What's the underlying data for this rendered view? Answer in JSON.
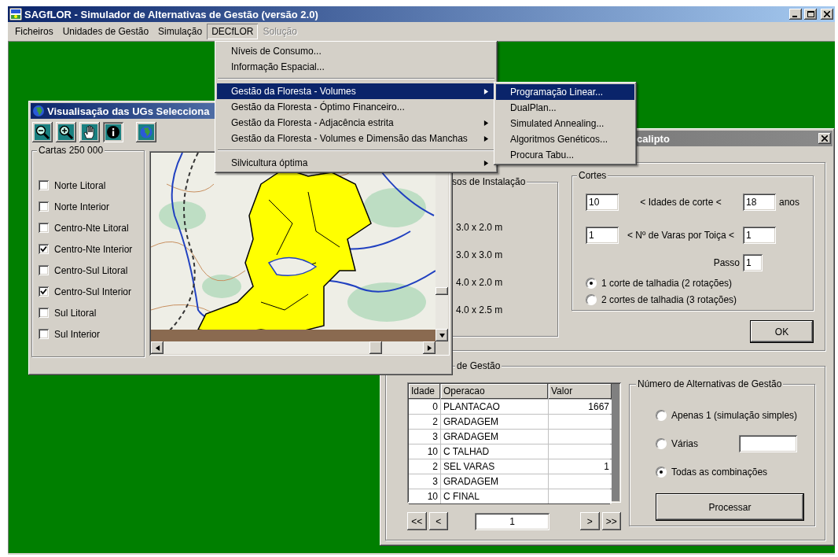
{
  "window": {
    "title": "SAGfLOR - Simulador de Alternativas de Gestão (versão 2.0)"
  },
  "menubar": [
    {
      "label": "Ficheiros",
      "open": false,
      "disabled": false
    },
    {
      "label": "Unidades de Gestão",
      "open": false,
      "disabled": false
    },
    {
      "label": "Simulação",
      "open": false,
      "disabled": false
    },
    {
      "label": "DECfLOR",
      "open": true,
      "disabled": false
    },
    {
      "label": "Solução",
      "open": false,
      "disabled": true
    }
  ],
  "menu": {
    "items": [
      {
        "kind": "item",
        "label": "Níveis de Consumo...",
        "selected": false,
        "submenu": false
      },
      {
        "kind": "item",
        "label": "Informação Espacial...",
        "selected": false,
        "submenu": false
      },
      {
        "kind": "separator"
      },
      {
        "kind": "item",
        "label": "Gestão da Floresta - Volumes",
        "selected": true,
        "submenu": true
      },
      {
        "kind": "item",
        "label": "Gestão da Floresta - Óptimo Financeiro...",
        "selected": false,
        "submenu": false
      },
      {
        "kind": "item",
        "label": "Gestão da Floresta - Adjacência estrita",
        "selected": false,
        "submenu": true
      },
      {
        "kind": "item",
        "label": "Gestão da Floresta - Volumes e Dimensão das Manchas",
        "selected": false,
        "submenu": true
      },
      {
        "kind": "separator"
      },
      {
        "kind": "item",
        "label": "Silvicultura óptima",
        "selected": false,
        "submenu": true
      }
    ]
  },
  "submenu": {
    "items": [
      {
        "label": "Programação Linear...",
        "selected": true
      },
      {
        "label": "DualPlan...",
        "selected": false
      },
      {
        "label": "Simulated Annealing...",
        "selected": false
      },
      {
        "label": "Algoritmos Genéticos...",
        "selected": false
      },
      {
        "label": "Procura Tabu...",
        "selected": false
      }
    ]
  },
  "map_window": {
    "title": "Visualisação das UGs Selecciona",
    "tools": [
      {
        "kind": "zoom-out",
        "pressed": false
      },
      {
        "kind": "zoom-in",
        "pressed": false
      },
      {
        "kind": "hand",
        "pressed": false
      },
      {
        "kind": "info",
        "pressed": true
      },
      {
        "kind": "globe",
        "pressed": false
      }
    ],
    "group": {
      "title": "Cartas 250 000",
      "items": [
        {
          "label": "Norte Litoral",
          "checked": false
        },
        {
          "label": "Norte Interior",
          "checked": false
        },
        {
          "label": "Centro-Nte Litoral",
          "checked": false
        },
        {
          "label": "Centro-Nte Interior",
          "checked": true
        },
        {
          "label": "Centro-Sul Litoral",
          "checked": false
        },
        {
          "label": "Centro-Sul Interior",
          "checked": true
        },
        {
          "label": "Sul Litoral",
          "checked": false
        },
        {
          "label": "Sul Interior",
          "checked": false
        }
      ]
    }
  },
  "dialog": {
    "title": "calipto",
    "spacing": {
      "title": "sos de Instalação",
      "options": [
        "3.0 x 2.0 m",
        "3.0 x 3.0 m",
        "4.0 x 2.0 m",
        "4.0 x 2.5 m"
      ]
    },
    "cuts": {
      "title": "Cortes",
      "age_min": "10",
      "age_label": "<  Idades de corte  <",
      "age_max": "18",
      "age_unit": "anos",
      "stems_min": "1",
      "stems_label": "< Nº de Varas por Toiça <",
      "stems_max": "1",
      "step_label": "Passo",
      "step": "1",
      "options": [
        {
          "label": "1 corte de talhadia (2 rotações)",
          "selected": true
        },
        {
          "label": "2 cortes de talhadia (3 rotações)",
          "selected": false
        }
      ]
    },
    "ok": "OK",
    "management": {
      "title": "de Gestão",
      "table": {
        "columns": [
          "Idade",
          "Operacao",
          "Valor"
        ],
        "rows": [
          [
            "0",
            "PLANTACAO",
            "1667"
          ],
          [
            "2",
            "GRADAGEM",
            ""
          ],
          [
            "3",
            "GRADAGEM",
            ""
          ],
          [
            "10",
            "C TALHAD",
            ""
          ],
          [
            "2",
            "SEL VARAS",
            "1"
          ],
          [
            "3",
            "GRADAGEM",
            ""
          ],
          [
            "10",
            "C FINAL",
            ""
          ]
        ]
      },
      "nav": {
        "first": "<<",
        "prev": "<",
        "page": "1",
        "next": ">",
        "last": ">>"
      },
      "alternatives": {
        "title": "Número de Alternativas de Gestão",
        "options": [
          {
            "kind": "plain",
            "label": "Apenas 1 (simulação simples)",
            "selected": false
          },
          {
            "kind": "field",
            "label": "Várias",
            "selected": false
          },
          {
            "kind": "plain",
            "label": "Todas as combinações",
            "selected": true
          }
        ],
        "button": "Processar"
      }
    }
  }
}
